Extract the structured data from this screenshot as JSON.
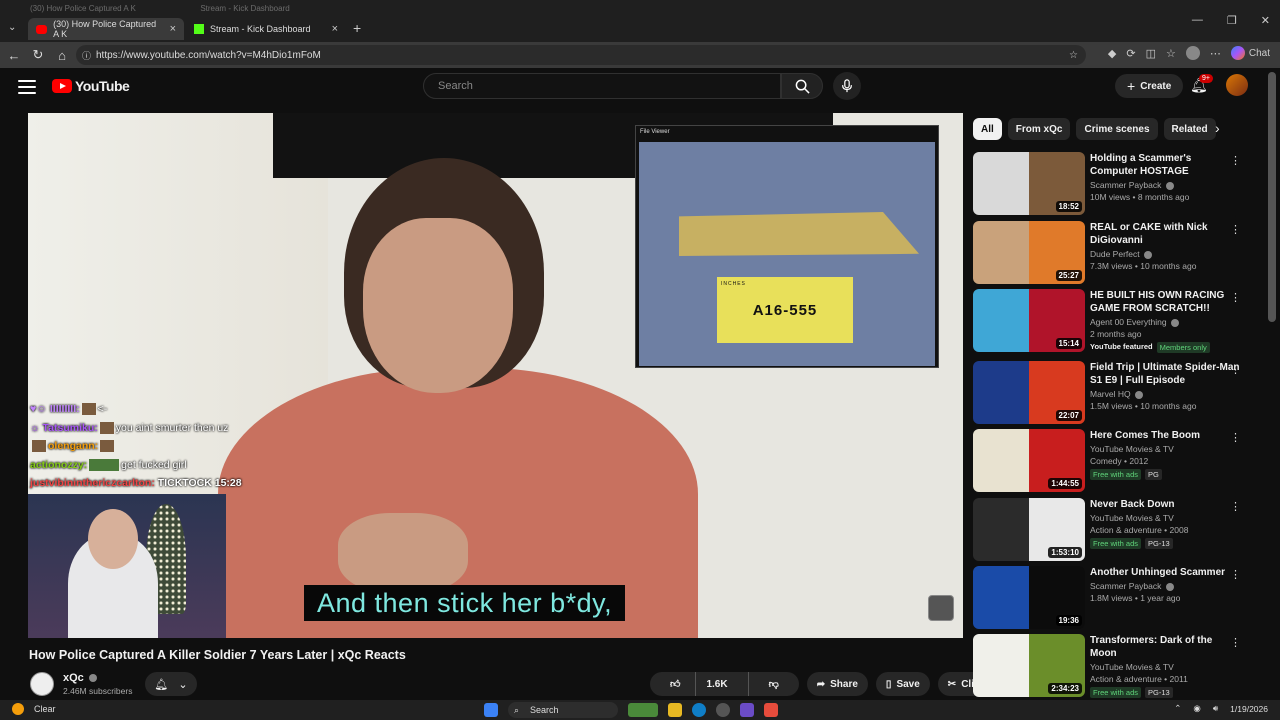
{
  "browser": {
    "tabs": [
      {
        "title": "(30) How Police Captured A K"
      },
      {
        "title": "Stream - Kick Dashboard"
      }
    ],
    "ghost_tabs": [
      {
        "title": "(30) How Police Captured A K"
      },
      {
        "title": "Stream - Kick Dashboard"
      }
    ],
    "url": "https://www.youtube.com/watch?v=M4hDio1mFoM",
    "chat_label": "Chat"
  },
  "header": {
    "logo_text": "YouTube",
    "search_placeholder": "Search",
    "create_label": "Create",
    "notif_count": "9+"
  },
  "player": {
    "file_viewer_title": "File Viewer",
    "evidence_label": "A16-555",
    "ruler_label": "INCHES",
    "caption": "And then stick her b*dy,",
    "chat": [
      {
        "user": "♥☺ IIIIIIIII:",
        "msg": "<-"
      },
      {
        "user": "☼ Tatsumiku:",
        "msg": "you aint smurter then uz"
      },
      {
        "user": "olengann:",
        "msg": ""
      },
      {
        "user": "actionozzy:",
        "msg": "get fucked girl"
      },
      {
        "user": "justvibininthericzcarlton:",
        "msg": "TICKTOCK 15:28"
      }
    ]
  },
  "video": {
    "title": "How Police Captured A Killer Soldier 7 Years Later | xQc Reacts",
    "channel": "xQc",
    "subscribers": "2.46M subscribers",
    "likes": "1.6K",
    "share_label": "Share",
    "save_label": "Save",
    "clip_label": "Clip"
  },
  "sidebar": {
    "chips": [
      "All",
      "From xQc",
      "Crime scenes",
      "Related"
    ],
    "recommendations": [
      {
        "title": "Holding a Scammer's Computer HOSTAGE",
        "channel": "Scammer Payback",
        "views": "10M views • 8 months ago",
        "duration": "18:52",
        "thumb": "#d9d9d9",
        "thumb2": "#7c5a3a"
      },
      {
        "title": "REAL or CAKE with Nick DiGiovanni",
        "channel": "Dude Perfect",
        "views": "7.3M views • 10 months ago",
        "duration": "25:27",
        "thumb": "#c9a27b",
        "thumb2": "#e07a2a"
      },
      {
        "title": "HE BUILT HIS OWN RACING GAME FROM SCRATCH!!",
        "channel": "Agent 00 Everything",
        "views": "2 months ago",
        "duration": "15:14",
        "thumb": "#3fa7d6",
        "thumb2": "#b0142a",
        "featured": "YouTube featured",
        "members": "Members only"
      },
      {
        "title": "Field Trip | Ultimate Spider-Man S1 E9 | Full Episode",
        "channel": "Marvel HQ",
        "views": "1.5M views • 10 months ago",
        "duration": "22:07",
        "thumb": "#1d3b8a",
        "thumb2": "#d83a1f"
      },
      {
        "title": "Here Comes The Boom",
        "channel": "YouTube Movies & TV",
        "views": "Comedy • 2012",
        "duration": "1:44:55",
        "thumb": "#e8e2d0",
        "thumb2": "#c81e1e",
        "ads": "Free with ads",
        "rating": "PG"
      },
      {
        "title": "Never Back Down",
        "channel": "YouTube Movies & TV",
        "views": "Action & adventure • 2008",
        "duration": "1:53:10",
        "thumb": "#2b2b2b",
        "thumb2": "#e8e8e8",
        "ads": "Free with ads",
        "rating": "PG-13"
      },
      {
        "title": "Another Unhinged Scammer",
        "channel": "Scammer Payback",
        "views": "1.8M views • 1 year ago",
        "duration": "19:36",
        "thumb": "#1a4ba8",
        "thumb2": "#0c0c0c"
      },
      {
        "title": "Transformers: Dark of the Moon",
        "channel": "YouTube Movies & TV",
        "views": "Action & adventure • 2011",
        "duration": "2:34:23",
        "thumb": "#f0f0ea",
        "thumb2": "#6b8e2a",
        "ads": "Free with ads",
        "rating": "PG-13"
      }
    ]
  },
  "taskbar": {
    "weather": "Clear",
    "search": "Search",
    "date": "1/19/2026"
  }
}
